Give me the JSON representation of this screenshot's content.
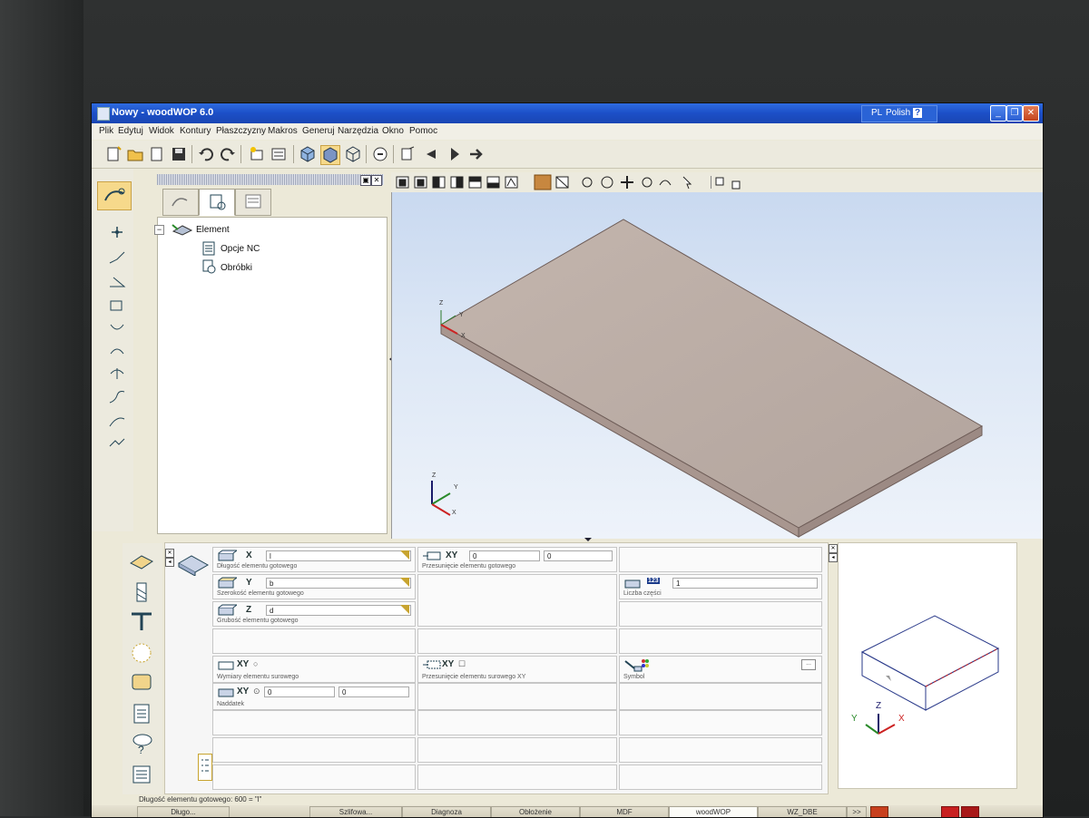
{
  "window": {
    "title": "Nowy - woodWOP 6.0",
    "lang_code": "PL",
    "lang_name": "Polish",
    "help": "?"
  },
  "menu": [
    "Plik",
    "Edytuj",
    "Widok",
    "Kontury",
    "Płaszczyzny",
    "Makros",
    "Generuj",
    "Narzędzia",
    "Okno",
    "Pomoc"
  ],
  "tree": {
    "root": "Element",
    "children": [
      "Opcje NC",
      "Obróbki"
    ]
  },
  "viewport": {
    "axis_z": "Z",
    "axis_y": "Y",
    "axis_x": "X"
  },
  "props": {
    "x_key": "X",
    "x_value": "l",
    "x_label": "Długość elementu gotowego",
    "y_key": "Y",
    "y_value": "b",
    "y_label": "Szerokość elementu gotowego",
    "z_key": "Z",
    "z_value": "d",
    "z_label": "Grubość elementu gotowego",
    "xy_key": "XY",
    "xy_value1": "0",
    "xy_value2": "0",
    "xy_label": "Przesunięcie elementu gotowego",
    "parts_key": "123",
    "parts_value": "1",
    "parts_label": "Liczba części",
    "raw_key": "XY",
    "raw_label": "Wymiary elementu surowego",
    "rawshift_key": "XY",
    "rawshift_label": "Przesunięcie elementu surowego XY",
    "symbol_label": "Symbol",
    "allow_key": "XY",
    "allow_value1": "0",
    "allow_value2": "0",
    "allow_label": "Naddatek",
    "dots": "..."
  },
  "preview": {
    "axis_z": "Z",
    "axis_y": "Y",
    "axis_x": "X"
  },
  "status": "Długość elementu gotowego: 600 = \"l\"",
  "taskbar": [
    "Długo...",
    "Szlifowa...",
    "Diagnoza",
    "Obłożenie",
    "MDF",
    "woodWOP",
    "WZ_DBE",
    ">>"
  ],
  "colors": {
    "title_blue": "#1c4fc7",
    "selected_tool": "#f6d98b",
    "panel_brown": "#b9a79d"
  }
}
